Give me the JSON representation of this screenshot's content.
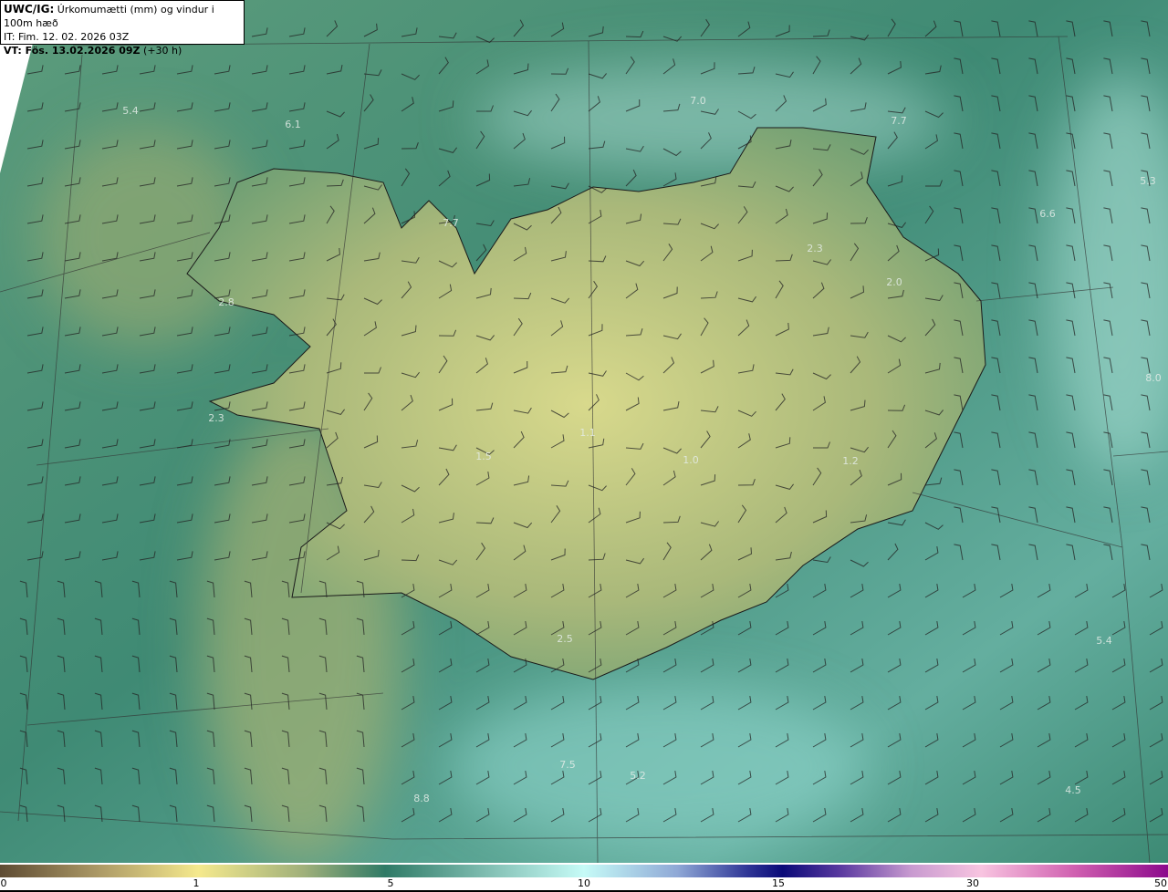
{
  "header": {
    "model": "UWC/IG:",
    "title": "Úrkomumætti (mm) og vindur i 100m hæð",
    "init_time": "IT: Fim. 12. 02. 2026 03Z",
    "valid_label": "VT: Fös. 13.02.2026 09Z",
    "valid_offset": "(+30 h)"
  },
  "colorbar": {
    "ticks": [
      "0",
      "1",
      "5",
      "10",
      "15",
      "30",
      "50"
    ],
    "colors": [
      "#5e4b33",
      "#f5e98d",
      "#2f7a66",
      "#c6fbf7",
      "#0a0a78",
      "#f8c4e0",
      "#8c0a8c"
    ]
  },
  "map_values": [
    "5.4",
    "6.1",
    "7.0",
    "7.7",
    "5.3",
    "6.6",
    "7.7",
    "2.3",
    "2.0",
    "2.8",
    "2.3",
    "1.1",
    "1.5",
    "1.0",
    "1.2",
    "8.0",
    "2.5",
    "5.4",
    "7.5",
    "5.2",
    "8.8",
    "4.5"
  ]
}
